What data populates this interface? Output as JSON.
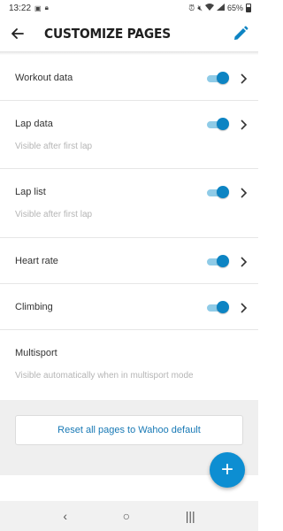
{
  "status_bar": {
    "time": "13:22",
    "icons_left": [
      "image-icon",
      "lock-icon"
    ],
    "icons_right": [
      "alarm-icon",
      "mute-icon",
      "wifi-icon",
      "signal-icon"
    ],
    "battery": "65%"
  },
  "app_bar": {
    "title": "CUSTOMIZE PAGES",
    "back_icon": "arrow-left-icon",
    "edit_icon": "pencil-icon"
  },
  "pages": [
    {
      "label": "Workout data",
      "subtitle": "",
      "enabled": true
    },
    {
      "label": "Lap data",
      "subtitle": "Visible after first lap",
      "enabled": true
    },
    {
      "label": "Lap list",
      "subtitle": "Visible after first lap",
      "enabled": true
    },
    {
      "label": "Heart rate",
      "subtitle": "",
      "enabled": true
    },
    {
      "label": "Climbing",
      "subtitle": "",
      "enabled": true
    },
    {
      "label": "Multisport",
      "subtitle": "Visible automatically when in multisport mode",
      "enabled": false
    }
  ],
  "reset_button": {
    "label": "Reset all pages to Wahoo default"
  },
  "fab": {
    "label": "+"
  },
  "nav_bar": {
    "back": "‹",
    "home": "○",
    "recents": "|||"
  },
  "colors": {
    "accent": "#0d84c3",
    "toggle_track": "#8fcbe7",
    "link": "#1879b5"
  }
}
